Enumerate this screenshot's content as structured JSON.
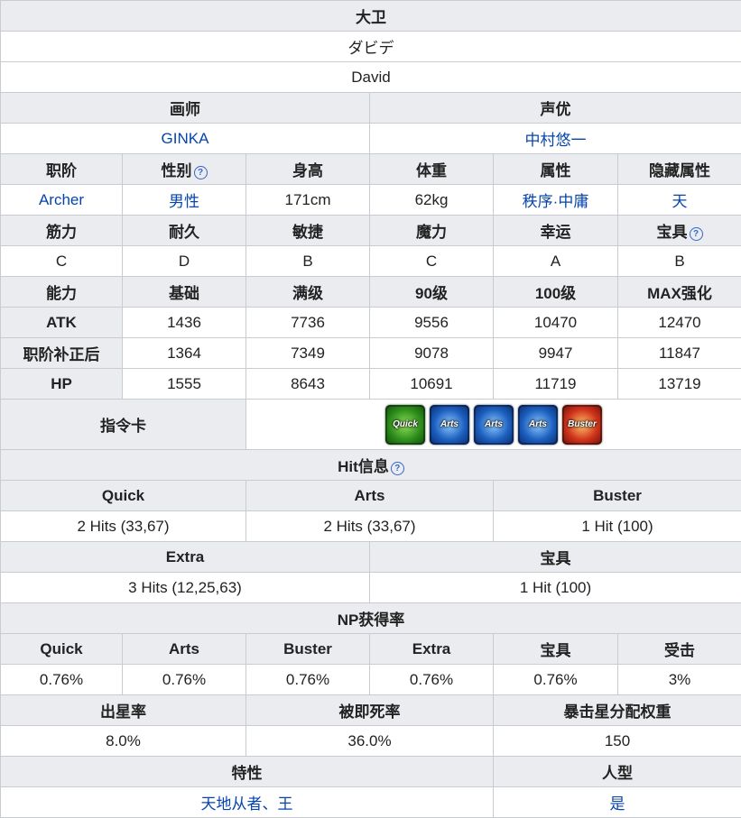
{
  "title": "大卫",
  "name_jp": "ダビデ",
  "name_en": "David",
  "labels": {
    "illustrator": "画师",
    "voice": "声优",
    "class": "职阶",
    "gender": "性别",
    "height": "身高",
    "weight": "体重",
    "attribute": "属性",
    "hidden_attribute": "隐藏属性",
    "strength": "筋力",
    "endurance": "耐久",
    "agility": "敏捷",
    "mana": "魔力",
    "luck": "幸运",
    "np": "宝具",
    "ability": "能力",
    "base": "基础",
    "max": "满级",
    "lv90": "90级",
    "lv100": "100级",
    "max_enhance": "MAX强化",
    "command_cards": "指令卡",
    "hit_info": "Hit信息",
    "quick": "Quick",
    "arts": "Arts",
    "buster": "Buster",
    "extra": "Extra",
    "np_gain": "NP获得率",
    "defense": "受击",
    "star_rate": "出星率",
    "death_rate": "被即死率",
    "star_weight": "暴击星分配权重",
    "traits": "特性",
    "humanoid": "人型"
  },
  "values": {
    "illustrator": "GINKA",
    "voice": "中村悠一",
    "class": "Archer",
    "gender": "男性",
    "height": "171cm",
    "weight": "62kg",
    "attribute": "秩序·中庸",
    "hidden_attribute": "天",
    "strength": "C",
    "endurance": "D",
    "agility": "B",
    "mana": "C",
    "luck": "A",
    "np": "B"
  },
  "stats": [
    {
      "label": "ATK",
      "base": "1436",
      "max": "7736",
      "lv90": "9556",
      "lv100": "10470",
      "max_enhance": "12470"
    },
    {
      "label": "职阶补正后",
      "base": "1364",
      "max": "7349",
      "lv90": "9078",
      "lv100": "9947",
      "max_enhance": "11847"
    },
    {
      "label": "HP",
      "base": "1555",
      "max": "8643",
      "lv90": "10691",
      "lv100": "11719",
      "max_enhance": "13719"
    }
  ],
  "cards": [
    {
      "type": "quick",
      "label": "Quick"
    },
    {
      "type": "arts",
      "label": "Arts"
    },
    {
      "type": "arts",
      "label": "Arts"
    },
    {
      "type": "arts",
      "label": "Arts"
    },
    {
      "type": "buster",
      "label": "Buster"
    }
  ],
  "hits": {
    "quick": "2 Hits (33,67)",
    "arts": "2 Hits (33,67)",
    "buster": "1 Hit (100)",
    "extra": "3 Hits (12,25,63)",
    "np": "1 Hit (100)"
  },
  "np_gain": {
    "quick": "0.76%",
    "arts": "0.76%",
    "buster": "0.76%",
    "extra": "0.76%",
    "np": "0.76%",
    "defense": "3%"
  },
  "star_rate": "8.0%",
  "death_rate": "36.0%",
  "star_weight": "150",
  "traits": "天地从者、王",
  "humanoid": "是",
  "colors": {
    "header_bg": "#eaecf0",
    "border": "#c8ccd1",
    "link": "#0645ad"
  }
}
